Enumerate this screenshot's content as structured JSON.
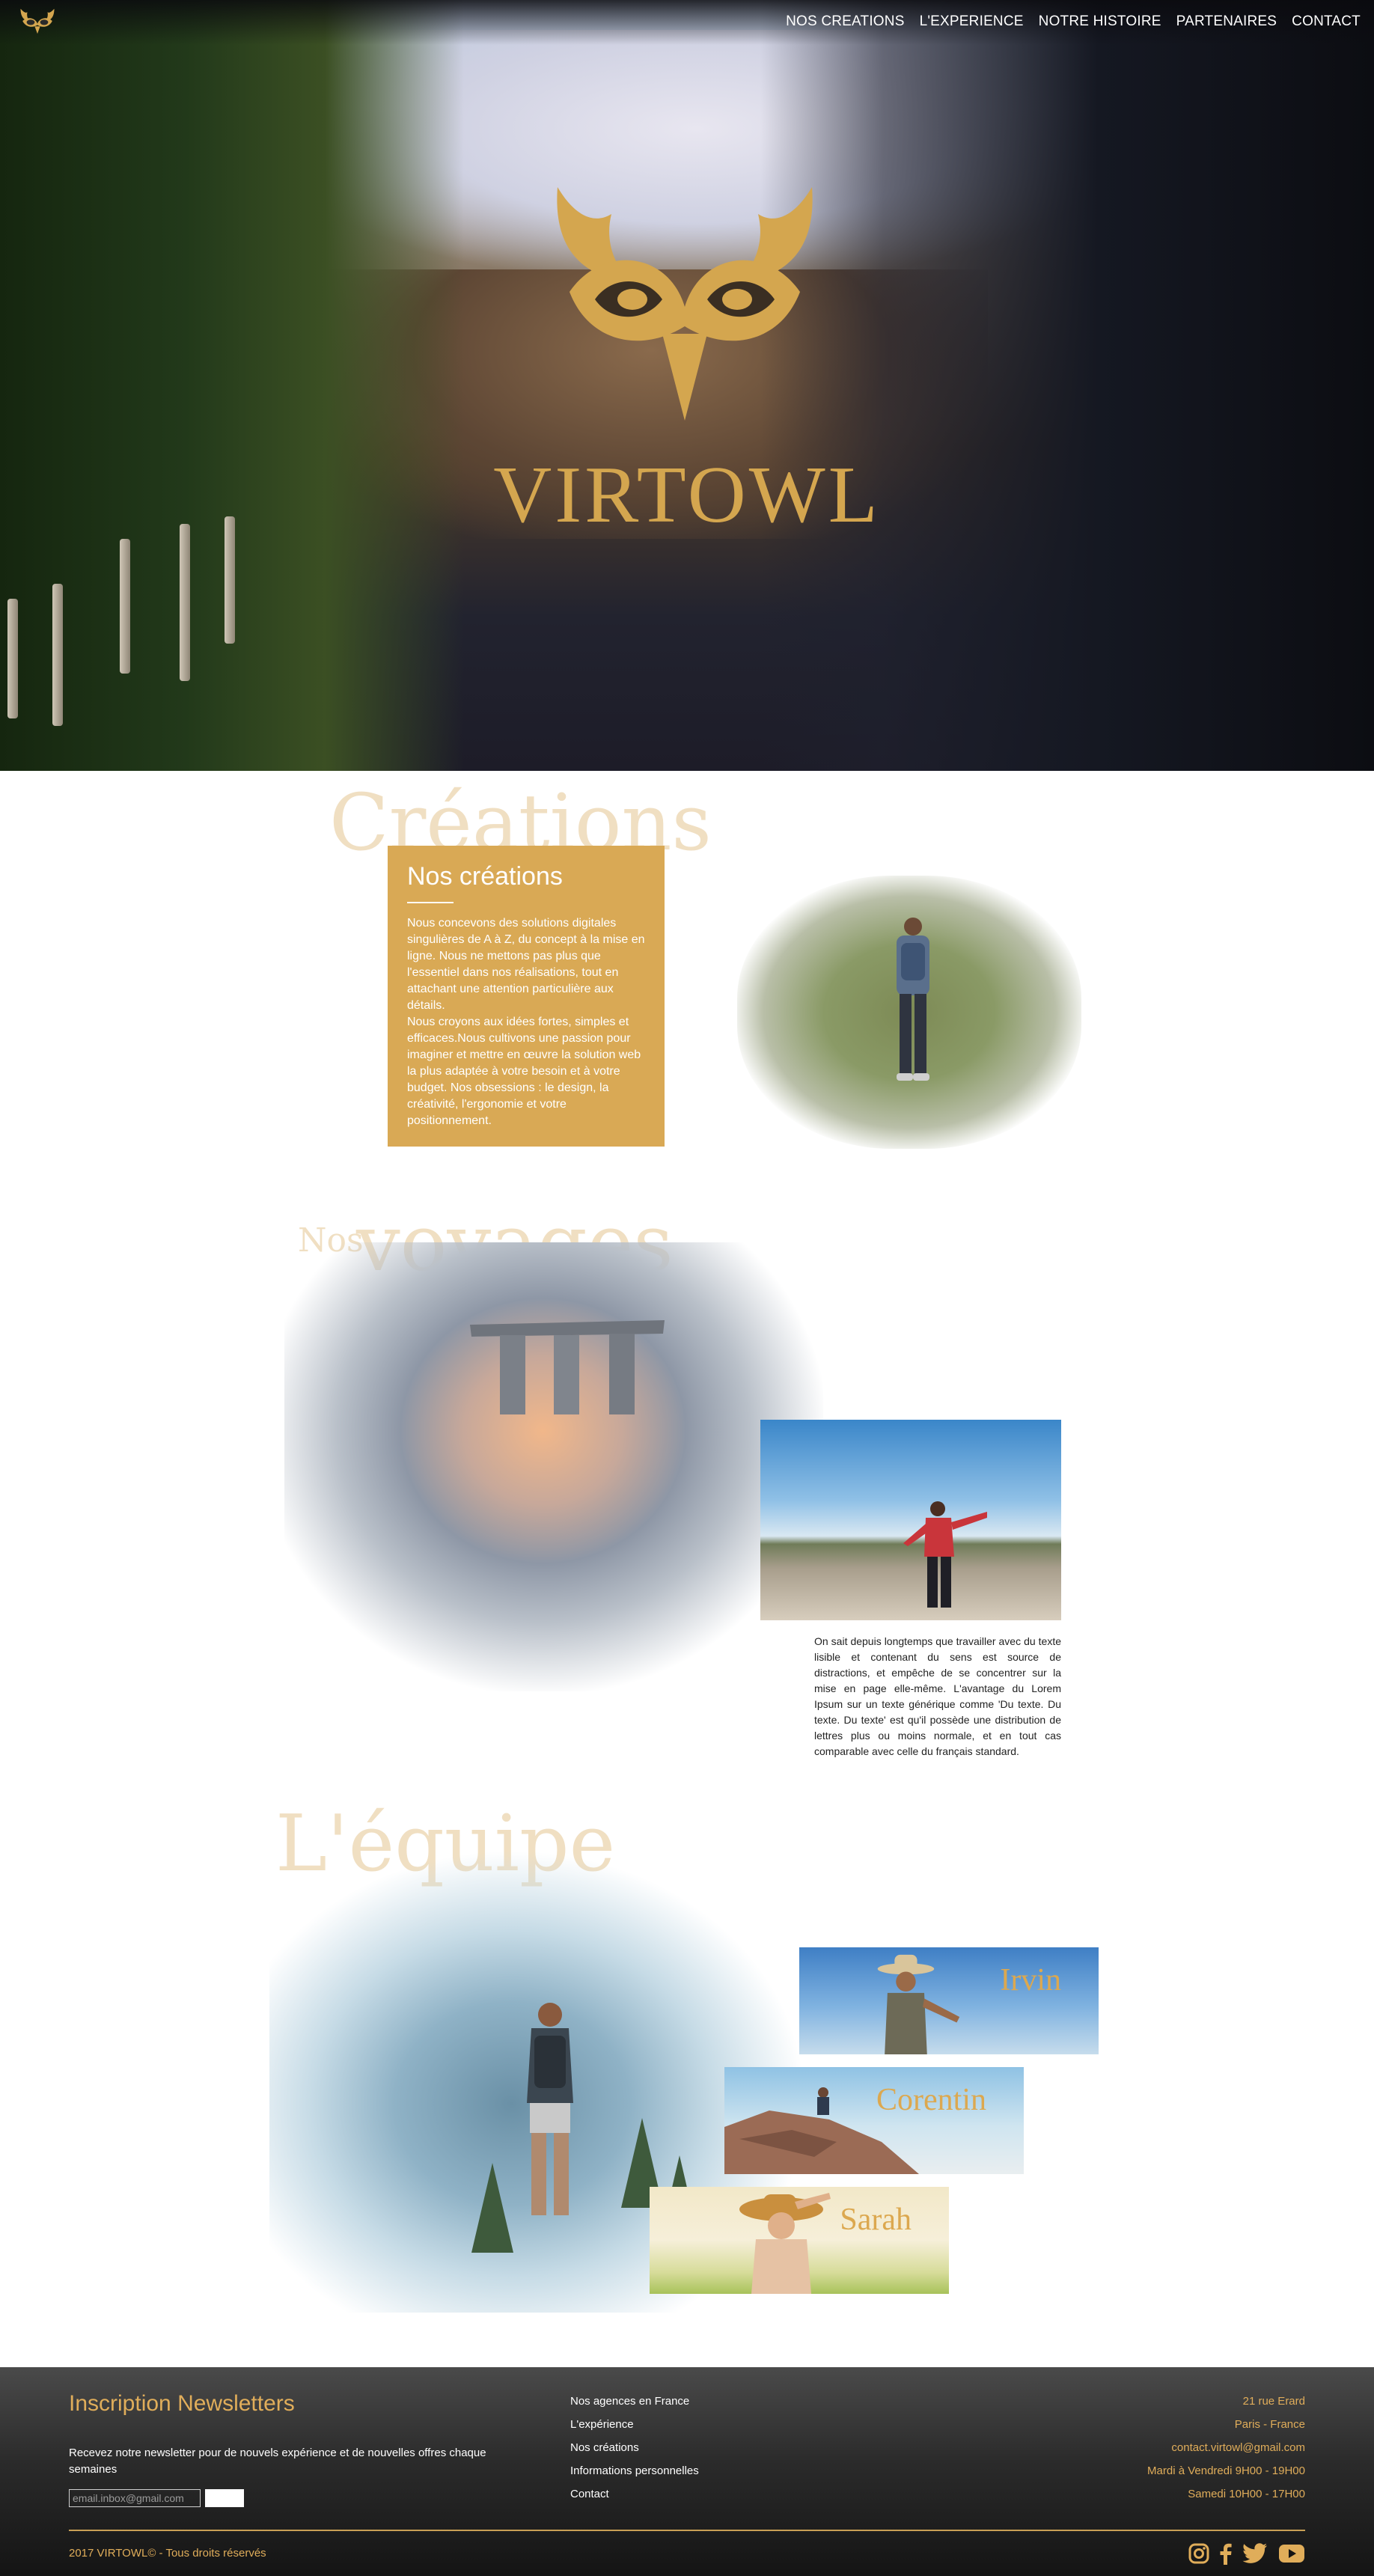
{
  "nav": {
    "items": [
      "NOS CREATIONS",
      "L'EXPERIENCE",
      "NOTRE HISTOIRE",
      "PARTENAIRES",
      "CONTACT"
    ]
  },
  "hero": {
    "brand": "VIRTOWL"
  },
  "creations": {
    "ghost_title": "Créations",
    "card_title": "Nos créations",
    "card_text": "Nous concevons des solutions digitales singulières de A à Z, du concept à la mise en ligne. Nous ne mettons pas plus que l'essentiel dans nos réalisations, tout en attachant une attention particulière aux détails.\nNous croyons aux idées fortes, simples et efficaces.Nous cultivons une passion pour imaginer et mettre en œuvre la solution web la plus adaptée à votre besoin et à votre budget. Nos obsessions : le design, la créativité, l'ergonomie et votre positionnement."
  },
  "voyages": {
    "ghost_small": "Nos",
    "ghost_title": "voyages",
    "text": "On sait depuis longtemps que travailler avec du texte lisible et contenant du sens est source de distractions, et empêche de se concentrer sur la mise en page elle-même. L'avantage du Lorem Ipsum sur un texte générique comme 'Du texte. Du texte. Du texte' est qu'il possède une distribution de lettres plus ou moins normale, et en tout cas comparable avec celle du français standard."
  },
  "equipe": {
    "ghost_title": "L'équipe",
    "members": [
      "Irvin",
      "Corentin",
      "Sarah"
    ]
  },
  "footer": {
    "newsletter_title": "Inscription Newsletters",
    "newsletter_text": "Recevez notre newsletter pour de nouvels expérience et de nouvelles offres chaque semaines",
    "email_placeholder": "email.inbox@gmail.com",
    "links": [
      "Nos agences en France",
      "L'expérience",
      "Nos créations",
      "Informations personnelles",
      "Contact"
    ],
    "contact": [
      "21 rue Erard",
      "Paris - France",
      "contact.virtowl@gmail.com",
      "Mardi à Vendredi 9H00 - 19H00",
      "Samedi 10H00 - 17H00"
    ],
    "copyright": "2017 VIRTOWL© - Tous droits réservés"
  },
  "icons": {
    "brand_logo": "owl-logo",
    "social": [
      "instagram-icon",
      "facebook-icon",
      "twitter-icon",
      "youtube-icon"
    ]
  },
  "colors": {
    "accent_gold": "#d9a955",
    "ghost_beige": "#f0dfc2",
    "footer_dark": "#2b2b2b"
  }
}
